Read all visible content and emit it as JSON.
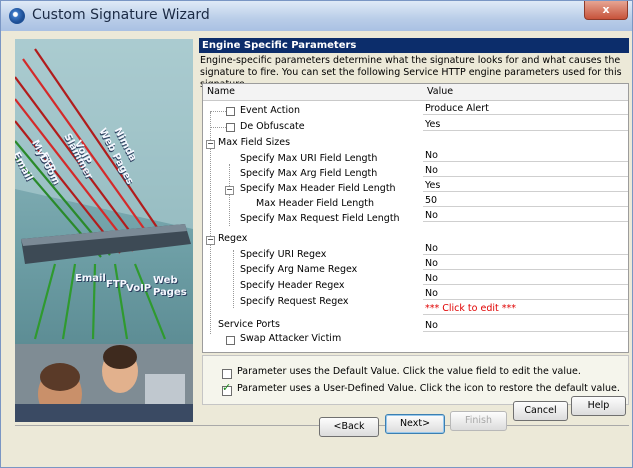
{
  "window": {
    "title": "Custom Signature Wizard",
    "close_label": "x"
  },
  "side_panel": {
    "top_words": [
      "Nimda",
      "Web Pages",
      "VoIP",
      "Slammer",
      "FTP",
      "MyDoom",
      "Email"
    ],
    "bottom_words": [
      "Email",
      "FTP",
      "VoIP",
      "Web",
      "Pages"
    ]
  },
  "page": {
    "header": "Engine Specific Parameters",
    "description": "Engine-specific parameters determine what the signature looks for and what causes the signature to fire. You can set the following Service HTTP engine parameters used for this signature."
  },
  "grid": {
    "col_name": "Name",
    "col_value": "Value",
    "rows": [
      {
        "label": "Event Action",
        "value": "Produce Alert"
      },
      {
        "label": "De Obfuscate",
        "value": "Yes"
      },
      {
        "label": "Max Field Sizes",
        "value": ""
      },
      {
        "label": "Specify Max URI Field Length",
        "value": "No"
      },
      {
        "label": "Specify Max Arg Field Length",
        "value": "No"
      },
      {
        "label": "Specify Max Header Field Length",
        "value": "Yes"
      },
      {
        "label": "Max Header Field Length",
        "value": "50"
      },
      {
        "label": "Specify Max Request Field Length",
        "value": "No"
      },
      {
        "label": "Regex",
        "value": ""
      },
      {
        "label": "Specify URI Regex",
        "value": "No"
      },
      {
        "label": "Specify Arg Name Regex",
        "value": "No"
      },
      {
        "label": "Specify Header Regex",
        "value": "No"
      },
      {
        "label": "Specify Request Regex",
        "value": "No"
      },
      {
        "label": "",
        "value": "*** Click to edit ***"
      },
      {
        "label": "Service Ports",
        "value": ""
      },
      {
        "label": "Swap Attacker Victim",
        "value": "No"
      }
    ]
  },
  "legend": {
    "default_text": "Parameter uses the Default Value.  Click the value field to edit the value.",
    "user_text": "Parameter uses a User-Defined Value.  Click the icon to restore the default value."
  },
  "buttons": {
    "back": "<Back",
    "next": "Next>",
    "finish": "Finish",
    "cancel": "Cancel",
    "help": "Help"
  }
}
